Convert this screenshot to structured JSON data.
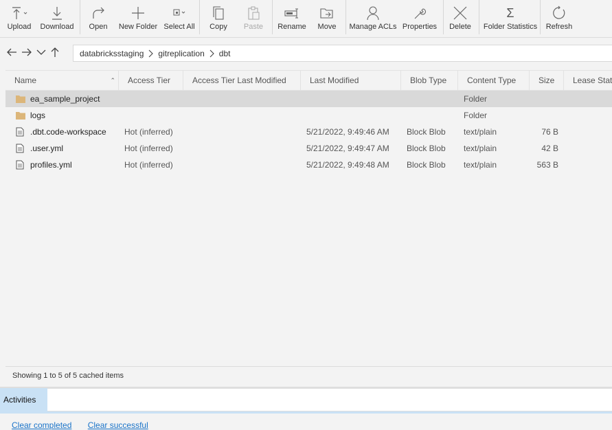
{
  "toolbar": {
    "upload": "Upload",
    "download": "Download",
    "open": "Open",
    "new_folder": "New Folder",
    "select_all": "Select All",
    "copy": "Copy",
    "paste": "Paste",
    "rename": "Rename",
    "move": "Move",
    "manage_acls": "Manage ACLs",
    "properties": "Properties",
    "delete": "Delete",
    "folder_statistics": "Folder Statistics",
    "refresh": "Refresh"
  },
  "breadcrumb": {
    "items": [
      "databricksstaging",
      "gitreplication",
      "dbt"
    ]
  },
  "columns": {
    "name": "Name",
    "access_tier": "Access Tier",
    "access_tier_modified": "Access Tier Last Modified",
    "last_modified": "Last Modified",
    "blob_type": "Blob Type",
    "content_type": "Content Type",
    "size": "Size",
    "lease_state": "Lease State"
  },
  "rows": [
    {
      "name": "ea_sample_project",
      "icon": "folder-icon",
      "access_tier": "",
      "last_modified": "",
      "blob_type": "",
      "content_type": "Folder",
      "size": ""
    },
    {
      "name": "logs",
      "icon": "folder-icon",
      "access_tier": "",
      "last_modified": "",
      "blob_type": "",
      "content_type": "Folder",
      "size": ""
    },
    {
      "name": ".dbt.code-workspace",
      "icon": "file-icon",
      "access_tier": "Hot (inferred)",
      "last_modified": "5/21/2022, 9:49:46 AM",
      "blob_type": "Block Blob",
      "content_type": "text/plain",
      "size": "76 B"
    },
    {
      "name": ".user.yml",
      "icon": "file-icon",
      "access_tier": "Hot (inferred)",
      "last_modified": "5/21/2022, 9:49:47 AM",
      "blob_type": "Block Blob",
      "content_type": "text/plain",
      "size": "42 B"
    },
    {
      "name": "profiles.yml",
      "icon": "file-icon",
      "access_tier": "Hot (inferred)",
      "last_modified": "5/21/2022, 9:49:48 AM",
      "blob_type": "Block Blob",
      "content_type": "text/plain",
      "size": "563 B"
    }
  ],
  "status": {
    "text": "Showing 1 to 5 of 5 cached items"
  },
  "activities": {
    "tab": "Activities",
    "clear_completed": "Clear completed",
    "clear_successful": "Clear successful"
  },
  "colors": {
    "folder": "#dcb67a",
    "selection": "#d9d9d9",
    "activity_tab": "#c9e1f5",
    "link": "#1a73c8"
  }
}
